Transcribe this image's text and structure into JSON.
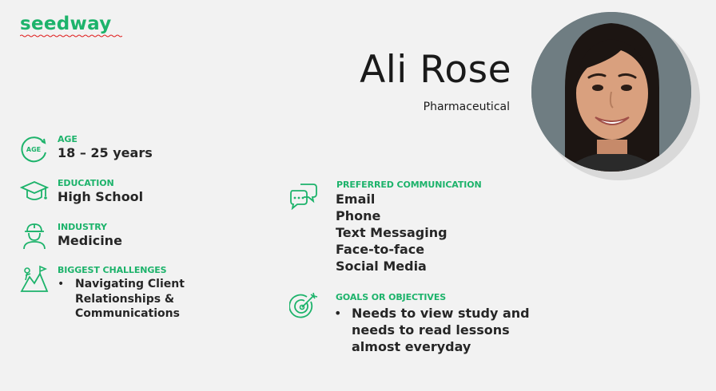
{
  "brand": {
    "logo_text": "seedway",
    "accent_color": "#1db36b"
  },
  "persona": {
    "name": "Ali Rose",
    "role": "Pharmaceutical"
  },
  "age": {
    "label": "AGE",
    "icon_text": "AGE",
    "value": "18 – 25 years",
    "icon": "age-circle-icon"
  },
  "education": {
    "label": "EDUCATION",
    "value": "High School",
    "icon": "graduation-cap-icon"
  },
  "industry": {
    "label": "INDUSTRY",
    "value": "Medicine",
    "icon": "worker-hardhat-icon"
  },
  "challenges": {
    "label": "BIGGEST CHALLENGES",
    "items": [
      "Navigating Client",
      "Relationships &",
      "Communications"
    ],
    "icon": "climbing-challenge-icon"
  },
  "communication": {
    "label": "PREFERRED COMMUNICATION",
    "items": [
      "Email",
      "Phone",
      "Text Messaging",
      "Face-to-face",
      "Social Media"
    ],
    "icon": "chat-bubbles-icon"
  },
  "goals": {
    "label": "GOALS OR OBJECTIVES",
    "items": [
      "Needs to view study and",
      "needs to read lessons",
      "almost everyday"
    ],
    "icon": "target-arrow-icon"
  }
}
